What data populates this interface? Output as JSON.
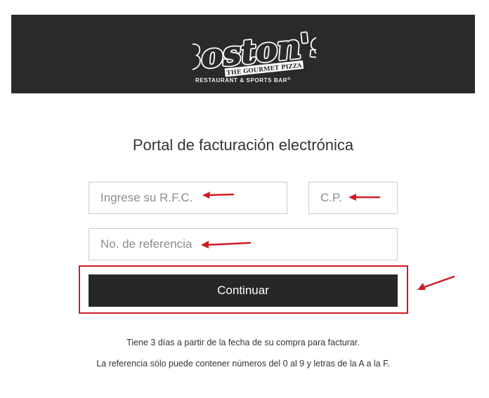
{
  "header": {
    "logo_text": "Boston's",
    "logo_tagline": "THE GOURMET PIZZA",
    "logo_subtitle": "RESTAURANT & SPORTS BAR",
    "logo_trademark": "®"
  },
  "portal": {
    "title": "Portal de facturación electrónica"
  },
  "form": {
    "rfc_placeholder": "Ingrese su R.F.C.",
    "cp_placeholder": "C.P.",
    "reference_placeholder": "No. de referencia",
    "continue_label": "Continuar"
  },
  "notes": {
    "deadline": "Tiene 3 días a partir de la fecha de su compra para facturar.",
    "reference_rule": "La referencia sólo puede contener números del 0 al 9 y letras de la A a la F."
  },
  "colors": {
    "header_bg": "#2a2a2a",
    "button_bg": "#272727",
    "annotation_red": "#d01c24"
  }
}
